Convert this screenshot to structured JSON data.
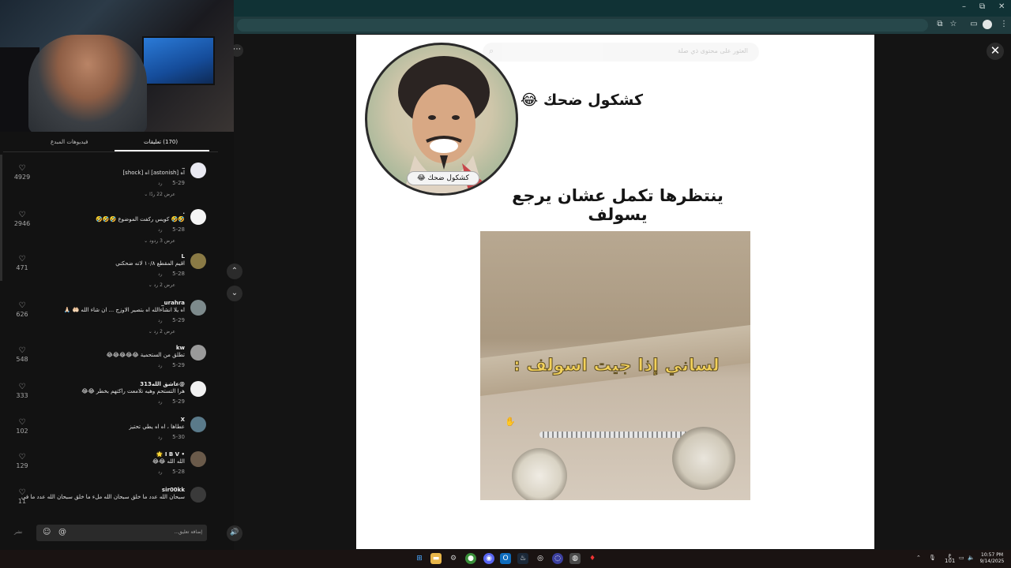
{
  "window": {
    "minimize": "–",
    "maximize": "⧉",
    "close": "✕"
  },
  "search": {
    "placeholder": "العثور على محتوى ذي صلة"
  },
  "video": {
    "channel_name": "كشكول ضحك 😂",
    "avatar_label": "كشكول ضحك 😂",
    "caption": "ينتظرها تكمل عشان يرجع يسولف",
    "clip_text": "لساني إذا جيت اسولف :"
  },
  "panel": {
    "tabs": [
      {
        "label": "(170) تعليقات",
        "active": true
      },
      {
        "label": "فيديوهات المبدع",
        "active": false
      }
    ],
    "comments": [
      {
        "user": "_",
        "text": "اه [astonish] اه [shock]",
        "date": "5-29",
        "reply": "رد",
        "replies": "عرض 22 ردًا ⌄",
        "likes": "4929",
        "avatar_color": "#e9e9f1"
      },
      {
        "user": ".",
        "text": "🤣🤣 كويس ركفت الموضوع 🤣🤣🤣",
        "date": "5-28",
        "reply": "رد",
        "replies": "عرض 3 ردود ⌄",
        "likes": "2946",
        "avatar_color": "#f4f4f4"
      },
      {
        "user": "L",
        "text": "اقيم المقطع ١٠/٨ لانه ضحكني",
        "date": "5-28",
        "reply": "رد",
        "replies": "عرض 2 رد ⌄",
        "likes": "471",
        "avatar_color": "#8a7a45"
      },
      {
        "user": "urahra_",
        "text": "اه يلا انشاءالله اه بتصير الاوزج ... ان شاء الله 🤲🏻 🙏🏻",
        "date": "5-29",
        "reply": "رد",
        "replies": "عرض 2 رد ⌄",
        "likes": "626",
        "avatar_color": "#7d8a8c"
      },
      {
        "user": "kw",
        "text": "تطلق من الستحمية 😂😂😂😂😂",
        "date": "5-29",
        "reply": "رد",
        "replies": "",
        "likes": "548",
        "avatar_color": "#9a9a9a"
      },
      {
        "user": "@عاشق الله313",
        "text": "هرا التستحم وهيه تلامعت راكتهم بخطر 😂😂",
        "date": "5-29",
        "reply": "رد",
        "replies": "",
        "likes": "333",
        "avatar_color": "#f1f1f1"
      },
      {
        "user": "X",
        "text": "عطاها ، اه اه يطي تحتيز",
        "date": "5-30",
        "reply": "رد",
        "replies": "",
        "likes": "102",
        "avatar_color": "#5a7a8a"
      },
      {
        "user": "• I B V 🌟",
        "text": "الله الله 😂😂",
        "date": "5-28",
        "reply": "رد",
        "replies": "",
        "likes": "129",
        "avatar_color": "#6a5a4a"
      },
      {
        "user": "sir00kk",
        "text": "سبحان الله عدد ما خلق سبحان الله ملء ما خلق سبحان الله عدد ما في",
        "date": "",
        "reply": "",
        "replies": "",
        "likes": "11",
        "avatar_color": "#3a3a3a"
      }
    ],
    "comment_placeholder": "إضافة تعليق...",
    "post_label": "نشر"
  },
  "taskbar": {
    "tray_lang": "ع",
    "tray_lang2": "101",
    "time": "10:57 PM",
    "date": "9/14/2025"
  },
  "colors": {
    "accent": "#4af0d0",
    "chrome": "#103235",
    "overlay": "#141414"
  }
}
